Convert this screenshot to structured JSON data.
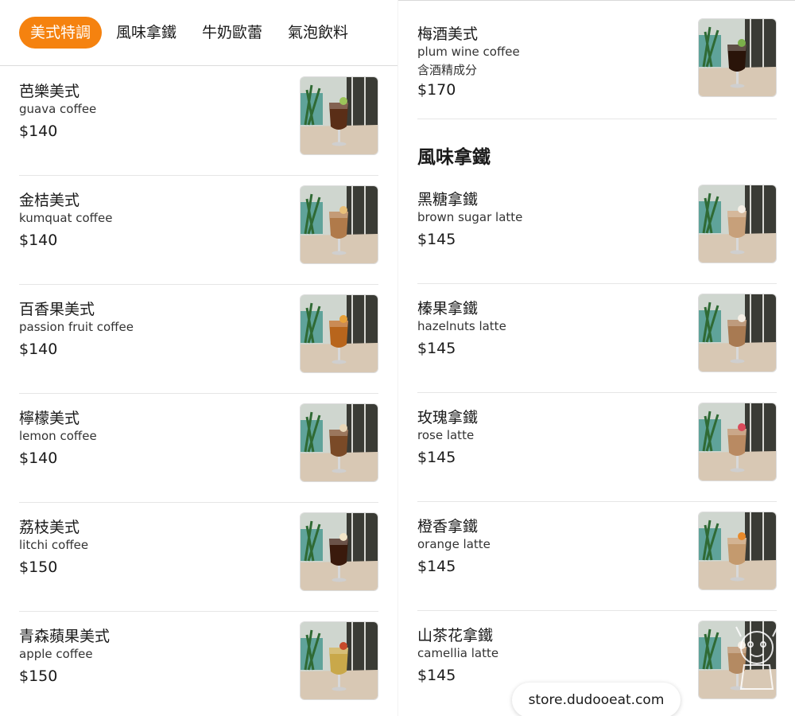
{
  "tabs": [
    {
      "label": "美式特調",
      "active": true
    },
    {
      "label": "風味拿鐵",
      "active": false
    },
    {
      "label": "牛奶歐蕾",
      "active": false
    },
    {
      "label": "氣泡飲料",
      "active": false
    }
  ],
  "left_items": [
    {
      "name": "芭樂美式",
      "en": "guava coffee",
      "price": "$140",
      "drink_color": "#5a2e17",
      "garnish": "#9cc45a"
    },
    {
      "name": "金桔美式",
      "en": "kumquat coffee",
      "price": "$140",
      "drink_color": "#b07a4a",
      "garnish": "#e9c07a"
    },
    {
      "name": "百香果美式",
      "en": "passion fruit coffee",
      "price": "$140",
      "drink_color": "#b8651c",
      "garnish": "#e8a23a"
    },
    {
      "name": "檸檬美式",
      "en": "lemon coffee",
      "price": "$140",
      "drink_color": "#7a4a27",
      "garnish": "#e9d7b8"
    },
    {
      "name": "荔枝美式",
      "en": "litchi coffee",
      "price": "$150",
      "drink_color": "#3a1a0c",
      "garnish": "#f2e6c8"
    },
    {
      "name": "青森蘋果美式",
      "en": "apple coffee",
      "price": "$150",
      "drink_color": "#c9a84a",
      "garnish": "#c74a2a"
    }
  ],
  "right_top_item": {
    "name": "梅酒美式",
    "en": "plum wine coffee",
    "note": "含酒精成分",
    "price": "$170",
    "drink_color": "#2a1409",
    "garnish": "#7bb04a"
  },
  "section_title": "風味拿鐵",
  "right_items": [
    {
      "name": "黑糖拿鐵",
      "en": "brown sugar latte",
      "price": "$145",
      "drink_color": "#c7a07a",
      "garnish": "#f5efe6"
    },
    {
      "name": "榛果拿鐵",
      "en": "hazelnuts latte",
      "price": "$145",
      "drink_color": "#a87a52",
      "garnish": "#f5efe6"
    },
    {
      "name": "玫瑰拿鐵",
      "en": "rose latte",
      "price": "$145",
      "drink_color": "#b98a62",
      "garnish": "#d94a5a"
    },
    {
      "name": "橙香拿鐵",
      "en": "orange latte",
      "price": "$145",
      "drink_color": "#c49a6e",
      "garnish": "#e88a2a"
    },
    {
      "name": "山茶花拿鐵",
      "en": "camellia latte",
      "price": "$145",
      "drink_color": "#b48a62",
      "garnish": "#f5efe6"
    }
  ],
  "site": "store.dudooeat.com",
  "colors": {
    "accent": "#f5820f"
  }
}
